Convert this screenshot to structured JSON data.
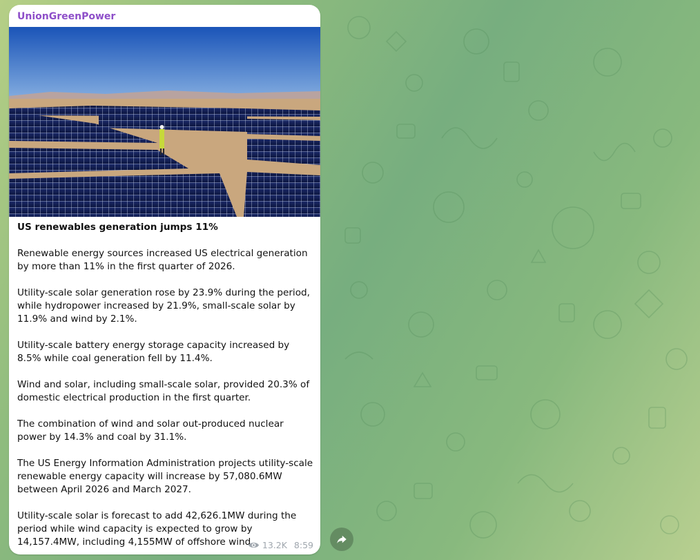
{
  "post": {
    "channel": "UnionGreenPower",
    "photo_icon": "solar-farm-photo",
    "title": "US renewables generation jumps 11%",
    "paragraphs": [
      "Renewable energy sources increased US electrical generation by more than 11% in the first quarter of 2026.",
      "Utility-scale solar generation rose by 23.9% during the period, while hydropower increased by 21.9%, small-scale solar by 11.9% and wind by 2.1%.",
      "Utility-scale battery energy storage capacity increased by 8.5% while coal generation fell by 11.4%.",
      "Wind and solar, including small-scale solar, provided 20.3% of domestic electrical production in the first quarter.",
      "The combination of wind and solar out-produced nuclear power by 14.3% and coal by 31.1%.",
      "The US Energy Information Administration projects utility-scale renewable energy capacity will increase by 57,080.6MW between April 2026 and March 2027.",
      "Utility-scale solar is forecast to add 42,626.1MW during the period while wind capacity is expected to grow by 14,157.4MW, including 4,155MW of offshore wind."
    ],
    "views": "13.2K",
    "time": "8:59"
  },
  "icons": {
    "views": "eye-icon",
    "share": "share-arrow-icon"
  },
  "colors": {
    "channel_name": "#8e4fc9",
    "meta_text": "#a0a7ae",
    "bubble": "#ffffff"
  }
}
